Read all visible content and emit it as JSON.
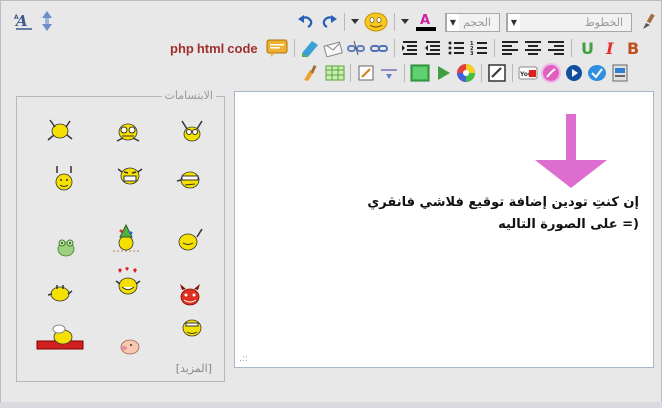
{
  "toolbar": {
    "font_select": "الخطوط",
    "size_select": "الحجم",
    "php_label": "php",
    "html_label": "html",
    "code_label": "code"
  },
  "smilies": {
    "legend": "الابتسامات",
    "more_link": "[المزيد]"
  },
  "editor": {
    "line1": "إن كنتِ تودين إضافة توقيع فلاشي فانقري",
    "line2": "على الصورة التاليه =)"
  },
  "colors": {
    "accent_pink": "#e060c0",
    "arrow": "#dd6ed0",
    "smiley_yellow": "#f5e000"
  }
}
